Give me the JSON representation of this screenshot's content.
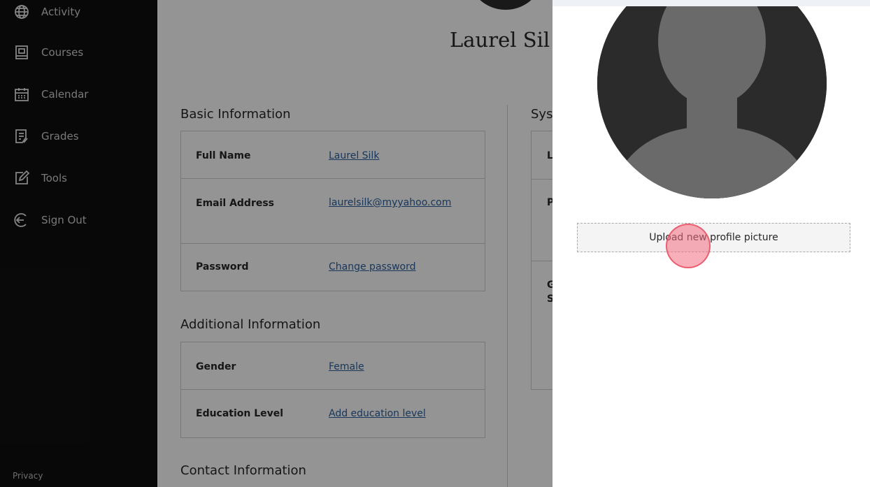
{
  "sidebar": {
    "items": [
      {
        "label": "Activity",
        "icon": "globe-icon"
      },
      {
        "label": "Courses",
        "icon": "book-icon"
      },
      {
        "label": "Calendar",
        "icon": "calendar-icon"
      },
      {
        "label": "Grades",
        "icon": "grades-icon"
      },
      {
        "label": "Tools",
        "icon": "tools-icon"
      },
      {
        "label": "Sign Out",
        "icon": "sign-out-icon"
      }
    ],
    "privacy": "Privacy"
  },
  "profile": {
    "name": "Laurel Sil",
    "basic_title": "Basic Information",
    "basic": [
      {
        "label": "Full Name",
        "value": "Laurel Silk"
      },
      {
        "label": "Email Address",
        "value": "laurelsilk@myyahoo.com"
      },
      {
        "label": "Password",
        "value": "Change password"
      }
    ],
    "additional_title": "Additional Information",
    "additional": [
      {
        "label": "Gender",
        "value": "Female"
      },
      {
        "label": "Education Level",
        "value": "Add education level"
      }
    ],
    "contact_title": "Contact Information",
    "system_title": "Sys",
    "system_letters": [
      "L",
      "P",
      "G",
      "S"
    ]
  },
  "panel": {
    "upload_label": "Upload new profile picture"
  },
  "colors": {
    "sidebar_bg": "#0f0f0f",
    "link": "#2a5f9e",
    "avatar_bg": "#2b2b2b",
    "click_marker": "#f46e82"
  }
}
